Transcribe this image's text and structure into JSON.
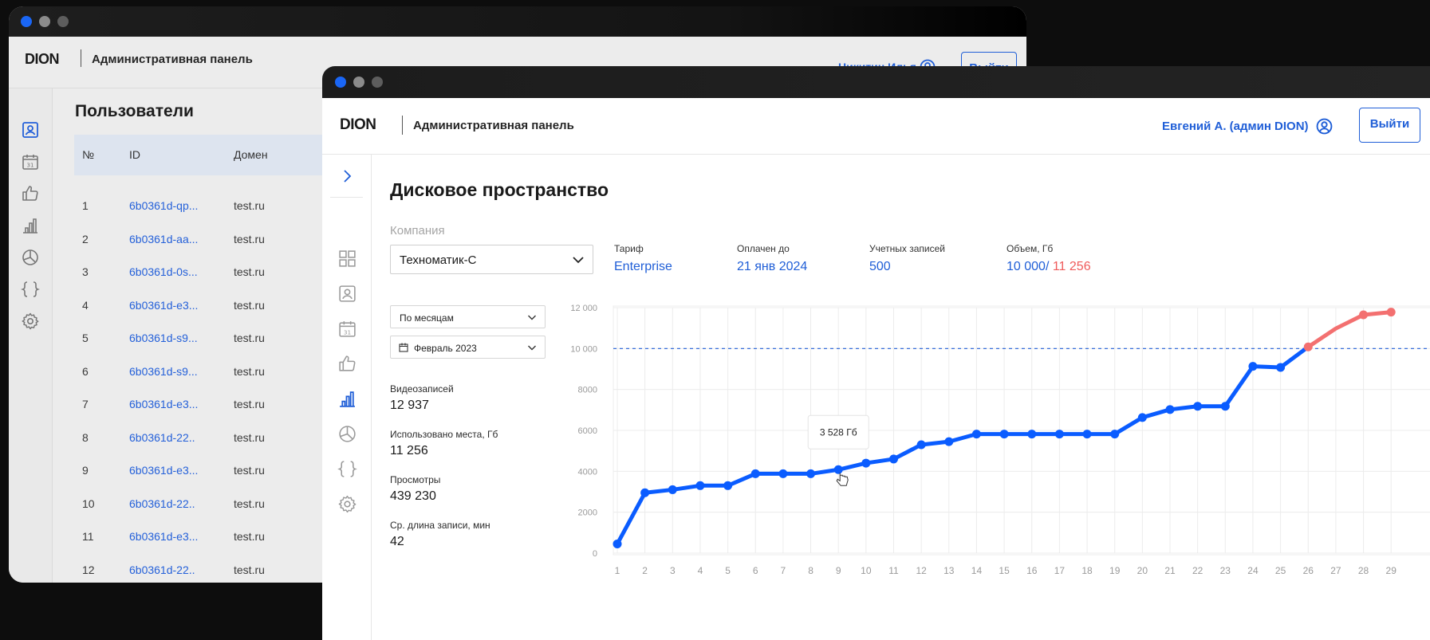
{
  "back_window": {
    "logo": "DION",
    "panel_title": "Административная панель",
    "user_name": "Никитин Илья",
    "exit_label": "Выйти",
    "page_title": "Пользователи",
    "table": {
      "headers": [
        "№",
        "ID",
        "Домен"
      ],
      "rows": [
        {
          "n": "1",
          "id": "6b0361d-qp...",
          "domain": "test.ru"
        },
        {
          "n": "2",
          "id": "6b0361d-aa...",
          "domain": "test.ru"
        },
        {
          "n": "3",
          "id": "6b0361d-0s...",
          "domain": "test.ru"
        },
        {
          "n": "4",
          "id": "6b0361d-e3...",
          "domain": "test.ru"
        },
        {
          "n": "5",
          "id": "6b0361d-s9...",
          "domain": "test.ru"
        },
        {
          "n": "6",
          "id": "6b0361d-s9...",
          "domain": "test.ru"
        },
        {
          "n": "7",
          "id": "6b0361d-e3...",
          "domain": "test.ru"
        },
        {
          "n": "8",
          "id": "6b0361d-22..",
          "domain": "test.ru"
        },
        {
          "n": "9",
          "id": "6b0361d-e3...",
          "domain": "test.ru"
        },
        {
          "n": "10",
          "id": "6b0361d-22..",
          "domain": "test.ru"
        },
        {
          "n": "11",
          "id": "6b0361d-e3...",
          "domain": "test.ru"
        },
        {
          "n": "12",
          "id": "6b0361d-22..",
          "domain": "test.ru"
        }
      ]
    },
    "sidebar_icons": [
      "user-card-icon",
      "calendar-icon",
      "thumbs-up-icon",
      "bar-chart-icon",
      "pie-chart-icon",
      "braces-icon",
      "gear-icon"
    ]
  },
  "front_window": {
    "logo": "DION",
    "panel_title": "Административная панель",
    "user_name": "Евгений А. (админ DION)",
    "exit_label": "Выйти",
    "page_title": "Дисковое пространство",
    "company_label": "Компания",
    "company_value": "Техноматик-С",
    "info": {
      "tariff_label": "Тариф",
      "tariff_value": "Enterprise",
      "paid_label": "Оплачен до",
      "paid_value": "21 янв 2024",
      "accounts_label": "Учетных записей",
      "accounts_value": "500",
      "volume_label": "Объем, Гб",
      "volume_limit": "10 000",
      "volume_separator": "/",
      "volume_used": "11 256"
    },
    "period_select": "По месяцам",
    "month_select": "Февраль 2023",
    "stats": [
      {
        "label": "Видеозаписей",
        "value": "12 937"
      },
      {
        "label": "Использовано места, Гб",
        "value": "11 256"
      },
      {
        "label": "Просмотры",
        "value": "439 230"
      },
      {
        "label": "Ср. длина записи, мин",
        "value": "42"
      }
    ],
    "sidebar_icons": [
      "chevron-right-icon",
      "grid-icon",
      "user-card-icon",
      "calendar-icon",
      "thumbs-up-icon",
      "bar-chart-icon",
      "pie-chart-icon",
      "braces-icon",
      "gear-icon"
    ],
    "colors": {
      "accent": "#0a5cff",
      "over_limit": "#f37070",
      "link": "#1f5ed7"
    }
  },
  "chart_data": {
    "type": "line",
    "x": [
      1,
      2,
      3,
      4,
      5,
      6,
      7,
      8,
      9,
      10,
      11,
      12,
      13,
      14,
      15,
      16,
      17,
      18,
      19,
      20,
      21,
      22,
      23,
      24,
      25,
      26,
      27,
      28,
      29
    ],
    "values": [
      450,
      2950,
      3100,
      3300,
      3300,
      3880,
      3880,
      3880,
      4080,
      4400,
      4600,
      5300,
      5450,
      5820,
      5820,
      5820,
      5820,
      5820,
      5820,
      6630,
      7020,
      7180,
      7180,
      9130,
      9080,
      10080,
      10980,
      11650,
      11780
    ],
    "limit": 10000,
    "ylim": [
      0,
      12000
    ],
    "y_ticks": [
      "0",
      "2000",
      "4000",
      "6000",
      "8000",
      "10 000",
      "12 000"
    ],
    "x_ticks": [
      "1",
      "2",
      "3",
      "4",
      "5",
      "6",
      "7",
      "8",
      "9",
      "10",
      "11",
      "12",
      "13",
      "14",
      "15",
      "16",
      "17",
      "18",
      "19",
      "20",
      "21",
      "22",
      "23",
      "24",
      "25",
      "26",
      "27",
      "28",
      "29"
    ],
    "tooltip": {
      "x": 9,
      "label": "3 528 Гб"
    },
    "grid": true
  }
}
